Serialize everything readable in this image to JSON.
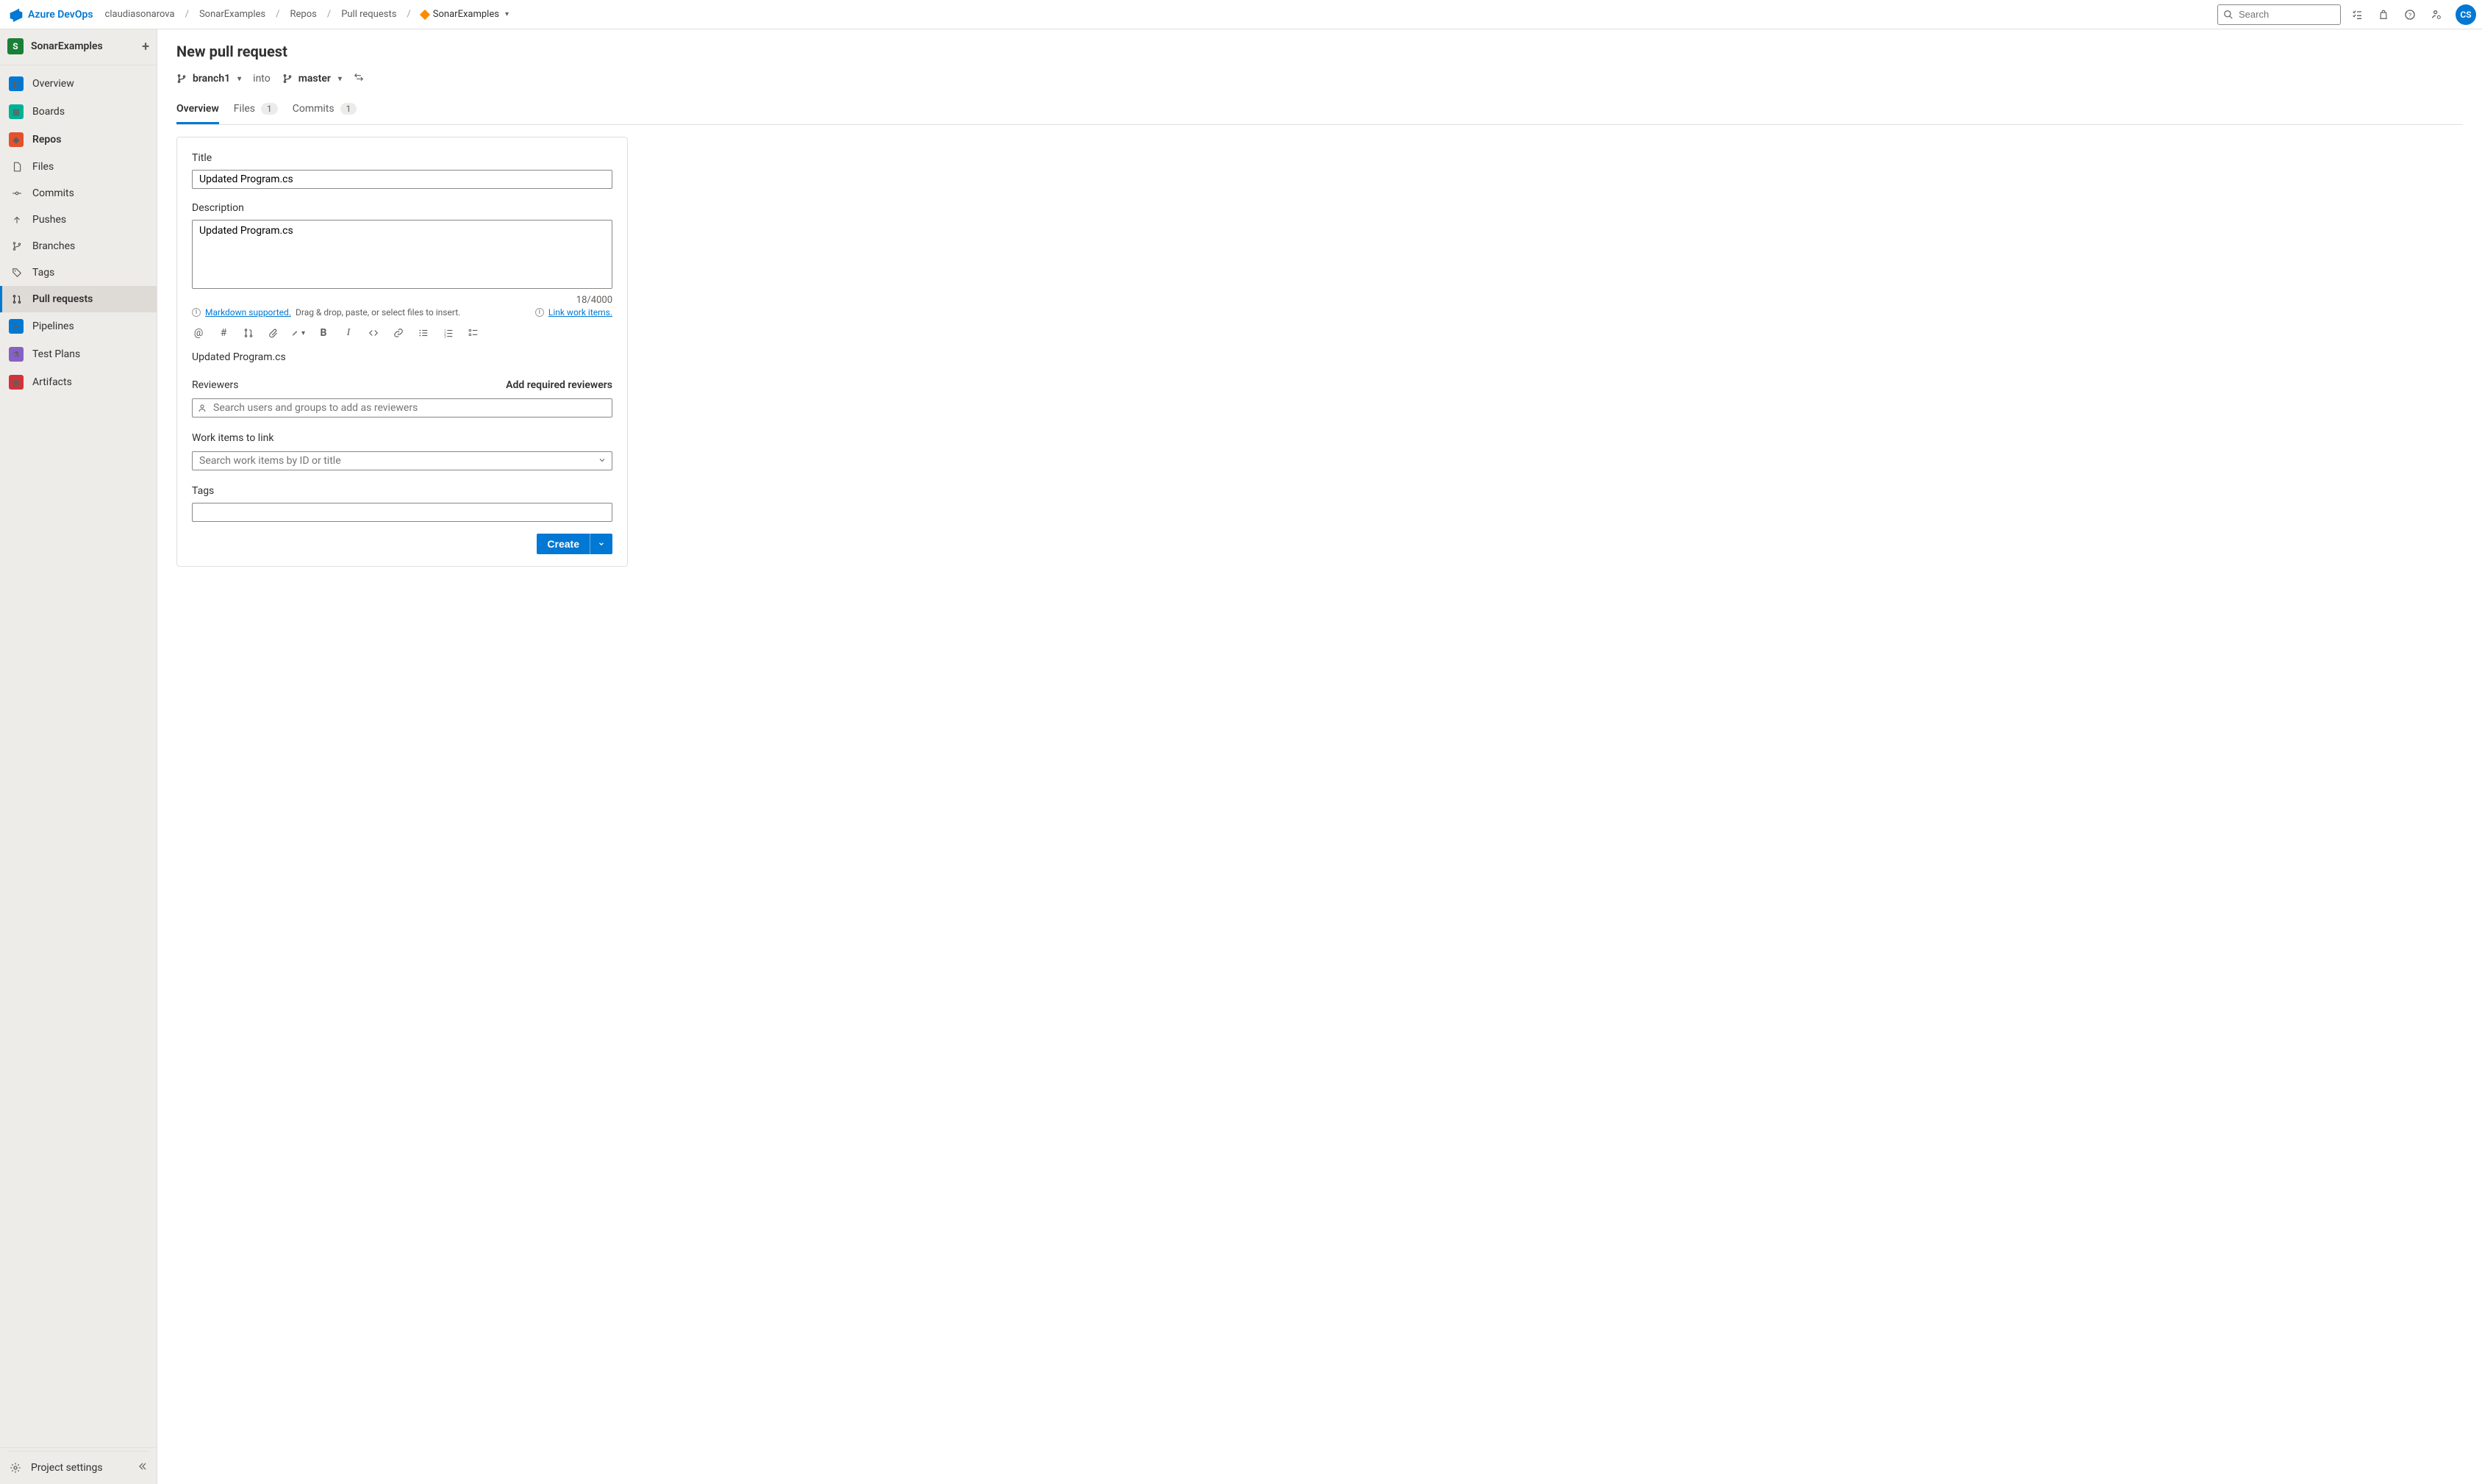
{
  "topbar": {
    "brand": "Azure DevOps",
    "crumbs": [
      "claudiasonarova",
      "SonarExamples",
      "Repos",
      "Pull requests"
    ],
    "repo": "SonarExamples",
    "search_placeholder": "Search",
    "avatar_initials": "CS"
  },
  "nav": {
    "project_name": "SonarExamples",
    "project_badge": "S",
    "top": [
      "Overview",
      "Boards"
    ],
    "repos_label": "Repos",
    "repo_sub": [
      "Files",
      "Commits",
      "Pushes",
      "Branches",
      "Tags",
      "Pull requests"
    ],
    "repo_sub_current_index": 5,
    "bottom": [
      "Pipelines",
      "Test Plans",
      "Artifacts"
    ],
    "settings_label": "Project settings"
  },
  "page": {
    "title": "New pull request",
    "source_branch": "branch1",
    "into_label": "into",
    "target_branch": "master",
    "tabs": {
      "overview": "Overview",
      "files": "Files",
      "files_count": "1",
      "commits": "Commits",
      "commits_count": "1"
    },
    "form": {
      "title_label": "Title",
      "title_value": "Updated Program.cs",
      "desc_label": "Description",
      "desc_value": "Updated Program.cs",
      "char_counter": "18/4000",
      "markdown_link": "Markdown supported.",
      "markdown_hint": "Drag & drop, paste, or select files to insert.",
      "link_work_items": "Link work items.",
      "preview_text": "Updated Program.cs",
      "reviewers_label": "Reviewers",
      "add_required": "Add required reviewers",
      "reviewers_placeholder": "Search users and groups to add as reviewers",
      "workitems_label": "Work items to link",
      "workitems_placeholder": "Search work items by ID or title",
      "tags_label": "Tags",
      "create_label": "Create"
    }
  }
}
